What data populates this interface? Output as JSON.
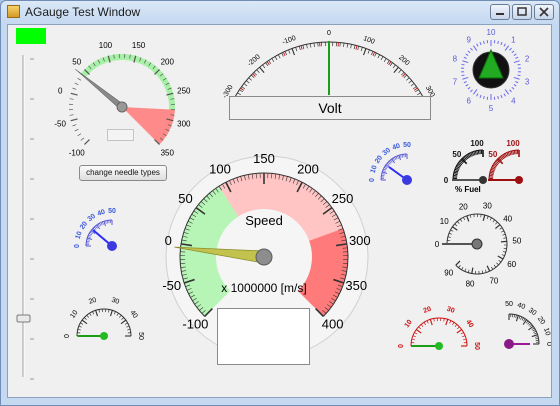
{
  "window": {
    "title": "AGauge Test Window",
    "buttons": [
      "minimize-button",
      "maximize-button",
      "close-button"
    ]
  },
  "colors": {
    "band_green": "#a8f0a8",
    "band_red": "#ff7a7a",
    "band_red_light": "#ffc4c4",
    "needle_gray": "#7a7a7a",
    "needle_yellow": "#b9b94b",
    "needle_green": "#1a9e1a",
    "needle_blue": "#2a2aff",
    "fuel_red": "#9e1010"
  },
  "controls": {
    "change_needle_label": "change needle types"
  },
  "gauge_top_left": {
    "labels": [
      "-100",
      "-50",
      "0",
      "50",
      "100",
      "150",
      "200",
      "250",
      "300",
      "350"
    ],
    "needle_value": 40
  },
  "volt_gauge": {
    "labels": [
      "-300",
      "-200",
      "-100",
      "0",
      "100",
      "200",
      "300"
    ],
    "caption": "Volt",
    "needle_value": 0
  },
  "dial_gauge": {
    "labels": [
      "10",
      "1",
      "2",
      "3",
      "4",
      "5",
      "6",
      "7",
      "8",
      "9"
    ]
  },
  "speed_gauge": {
    "labels": [
      "-100",
      "-50",
      "0",
      "50",
      "100",
      "150",
      "200",
      "250",
      "300",
      "350",
      "400"
    ],
    "title": "Speed",
    "units": "x 1000000 [m/s]",
    "needle_value": -5
  },
  "small_blue_top": {
    "labels": [
      "0",
      "10",
      "20",
      "30",
      "40",
      "50"
    ],
    "needle_value": 46
  },
  "small_blue_left": {
    "labels": [
      "0",
      "10",
      "20",
      "30",
      "40",
      "50"
    ],
    "needle_value": 45
  },
  "fuel_gauge": {
    "black_labels": [
      "0",
      "50",
      "100"
    ],
    "red_labels": [
      "0",
      "50",
      "100"
    ],
    "caption": "% Fuel",
    "black_value": 0,
    "red_value": 0
  },
  "round_gauge": {
    "labels": [
      "0",
      "10",
      "20",
      "30",
      "40",
      "50",
      "60",
      "70",
      "80",
      "90"
    ],
    "needle_value": 0
  },
  "bottom_left_gauge": {
    "labels": [
      "0",
      "10",
      "20",
      "30",
      "40",
      "50"
    ],
    "needle_value": 0
  },
  "bottom_red_gauge": {
    "labels": [
      "0",
      "10",
      "20",
      "30",
      "40",
      "50"
    ],
    "needle_value": 0
  },
  "bottom_right_gauge": {
    "labels": [
      "0",
      "10",
      "20",
      "30",
      "40",
      "50"
    ],
    "needle_value": 0
  }
}
